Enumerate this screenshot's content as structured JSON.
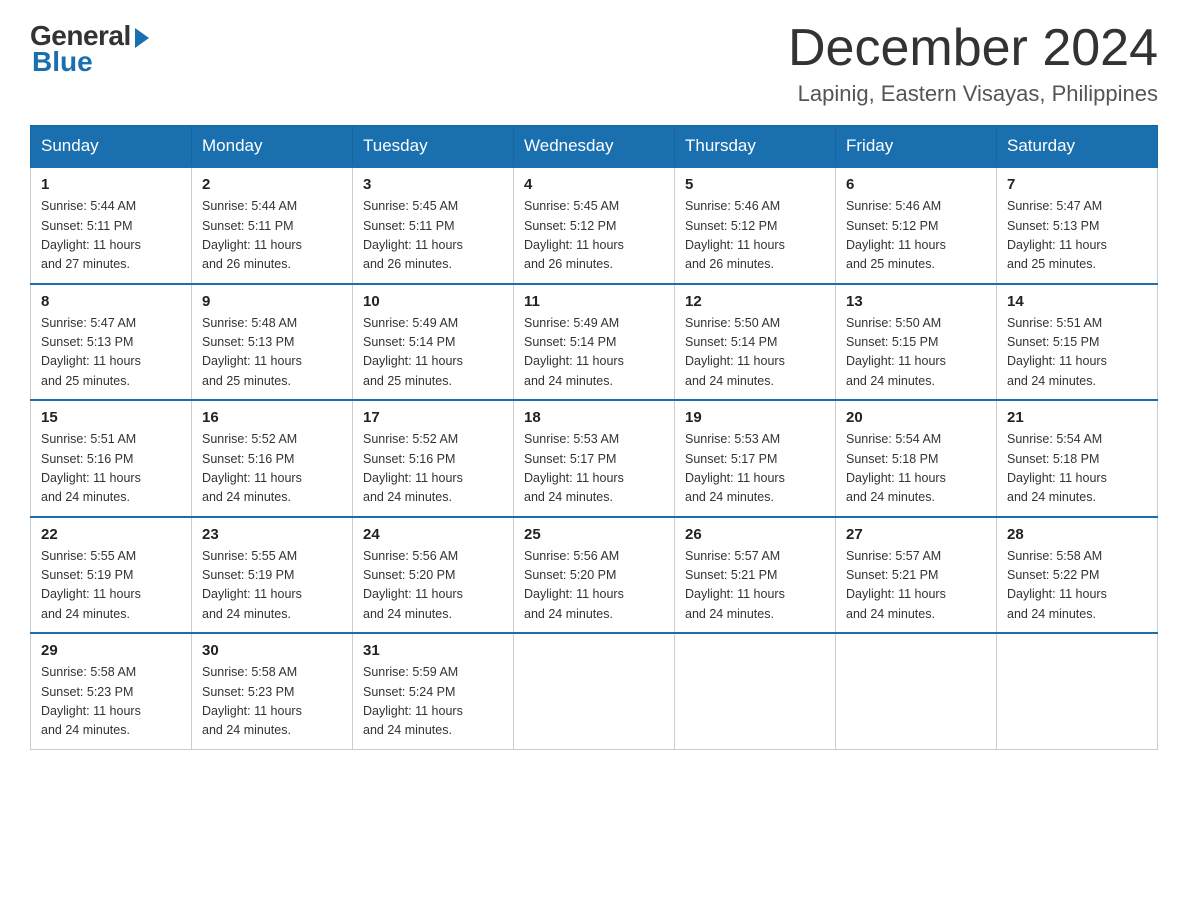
{
  "header": {
    "logo_general": "General",
    "logo_blue": "Blue",
    "month_title": "December 2024",
    "location": "Lapinig, Eastern Visayas, Philippines"
  },
  "days_of_week": [
    "Sunday",
    "Monday",
    "Tuesday",
    "Wednesday",
    "Thursday",
    "Friday",
    "Saturday"
  ],
  "weeks": [
    [
      {
        "day": "1",
        "sunrise": "5:44 AM",
        "sunset": "5:11 PM",
        "daylight": "11 hours and 27 minutes."
      },
      {
        "day": "2",
        "sunrise": "5:44 AM",
        "sunset": "5:11 PM",
        "daylight": "11 hours and 26 minutes."
      },
      {
        "day": "3",
        "sunrise": "5:45 AM",
        "sunset": "5:11 PM",
        "daylight": "11 hours and 26 minutes."
      },
      {
        "day": "4",
        "sunrise": "5:45 AM",
        "sunset": "5:12 PM",
        "daylight": "11 hours and 26 minutes."
      },
      {
        "day": "5",
        "sunrise": "5:46 AM",
        "sunset": "5:12 PM",
        "daylight": "11 hours and 26 minutes."
      },
      {
        "day": "6",
        "sunrise": "5:46 AM",
        "sunset": "5:12 PM",
        "daylight": "11 hours and 25 minutes."
      },
      {
        "day": "7",
        "sunrise": "5:47 AM",
        "sunset": "5:13 PM",
        "daylight": "11 hours and 25 minutes."
      }
    ],
    [
      {
        "day": "8",
        "sunrise": "5:47 AM",
        "sunset": "5:13 PM",
        "daylight": "11 hours and 25 minutes."
      },
      {
        "day": "9",
        "sunrise": "5:48 AM",
        "sunset": "5:13 PM",
        "daylight": "11 hours and 25 minutes."
      },
      {
        "day": "10",
        "sunrise": "5:49 AM",
        "sunset": "5:14 PM",
        "daylight": "11 hours and 25 minutes."
      },
      {
        "day": "11",
        "sunrise": "5:49 AM",
        "sunset": "5:14 PM",
        "daylight": "11 hours and 24 minutes."
      },
      {
        "day": "12",
        "sunrise": "5:50 AM",
        "sunset": "5:14 PM",
        "daylight": "11 hours and 24 minutes."
      },
      {
        "day": "13",
        "sunrise": "5:50 AM",
        "sunset": "5:15 PM",
        "daylight": "11 hours and 24 minutes."
      },
      {
        "day": "14",
        "sunrise": "5:51 AM",
        "sunset": "5:15 PM",
        "daylight": "11 hours and 24 minutes."
      }
    ],
    [
      {
        "day": "15",
        "sunrise": "5:51 AM",
        "sunset": "5:16 PM",
        "daylight": "11 hours and 24 minutes."
      },
      {
        "day": "16",
        "sunrise": "5:52 AM",
        "sunset": "5:16 PM",
        "daylight": "11 hours and 24 minutes."
      },
      {
        "day": "17",
        "sunrise": "5:52 AM",
        "sunset": "5:16 PM",
        "daylight": "11 hours and 24 minutes."
      },
      {
        "day": "18",
        "sunrise": "5:53 AM",
        "sunset": "5:17 PM",
        "daylight": "11 hours and 24 minutes."
      },
      {
        "day": "19",
        "sunrise": "5:53 AM",
        "sunset": "5:17 PM",
        "daylight": "11 hours and 24 minutes."
      },
      {
        "day": "20",
        "sunrise": "5:54 AM",
        "sunset": "5:18 PM",
        "daylight": "11 hours and 24 minutes."
      },
      {
        "day": "21",
        "sunrise": "5:54 AM",
        "sunset": "5:18 PM",
        "daylight": "11 hours and 24 minutes."
      }
    ],
    [
      {
        "day": "22",
        "sunrise": "5:55 AM",
        "sunset": "5:19 PM",
        "daylight": "11 hours and 24 minutes."
      },
      {
        "day": "23",
        "sunrise": "5:55 AM",
        "sunset": "5:19 PM",
        "daylight": "11 hours and 24 minutes."
      },
      {
        "day": "24",
        "sunrise": "5:56 AM",
        "sunset": "5:20 PM",
        "daylight": "11 hours and 24 minutes."
      },
      {
        "day": "25",
        "sunrise": "5:56 AM",
        "sunset": "5:20 PM",
        "daylight": "11 hours and 24 minutes."
      },
      {
        "day": "26",
        "sunrise": "5:57 AM",
        "sunset": "5:21 PM",
        "daylight": "11 hours and 24 minutes."
      },
      {
        "day": "27",
        "sunrise": "5:57 AM",
        "sunset": "5:21 PM",
        "daylight": "11 hours and 24 minutes."
      },
      {
        "day": "28",
        "sunrise": "5:58 AM",
        "sunset": "5:22 PM",
        "daylight": "11 hours and 24 minutes."
      }
    ],
    [
      {
        "day": "29",
        "sunrise": "5:58 AM",
        "sunset": "5:23 PM",
        "daylight": "11 hours and 24 minutes."
      },
      {
        "day": "30",
        "sunrise": "5:58 AM",
        "sunset": "5:23 PM",
        "daylight": "11 hours and 24 minutes."
      },
      {
        "day": "31",
        "sunrise": "5:59 AM",
        "sunset": "5:24 PM",
        "daylight": "11 hours and 24 minutes."
      },
      null,
      null,
      null,
      null
    ]
  ],
  "labels": {
    "sunrise": "Sunrise:",
    "sunset": "Sunset:",
    "daylight": "Daylight:"
  }
}
